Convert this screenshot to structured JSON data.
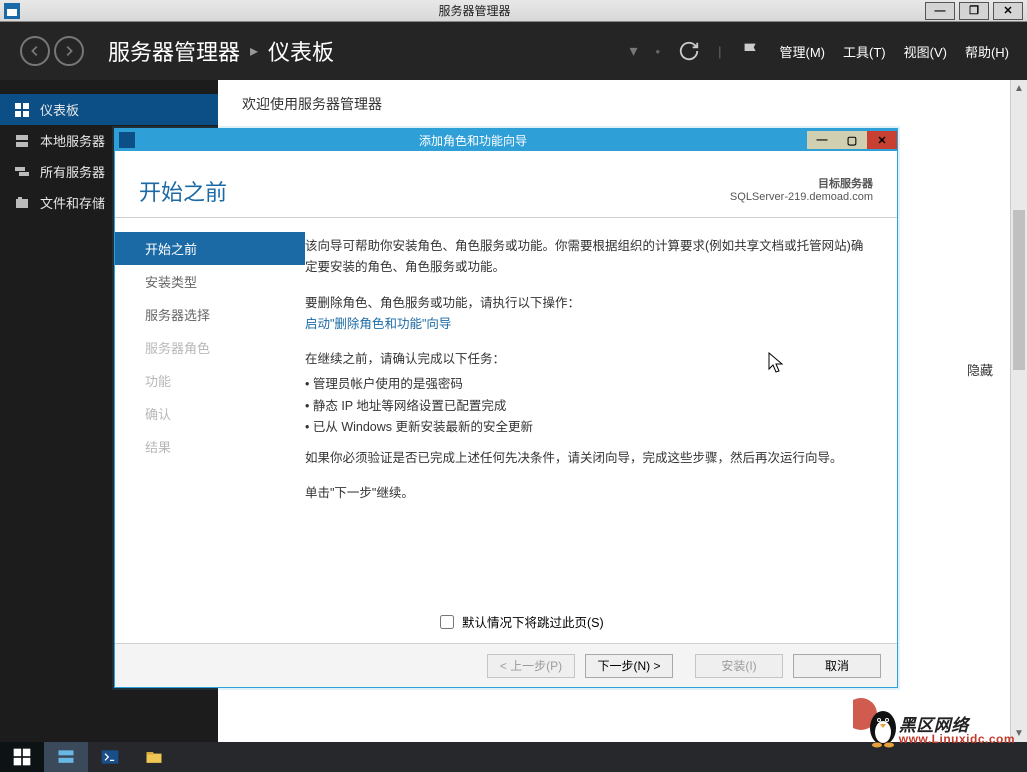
{
  "outerWindow": {
    "title": "服务器管理器",
    "minimize": "—",
    "maximize": "❐",
    "close": "✕"
  },
  "header": {
    "breadcrumb1": "服务器管理器",
    "breadcrumb2": "仪表板",
    "menu": {
      "manage": "管理(M)",
      "tools": "工具(T)",
      "view": "视图(V)",
      "help": "帮助(H)"
    }
  },
  "sidebar": {
    "items": [
      {
        "label": "仪表板"
      },
      {
        "label": "本地服务器"
      },
      {
        "label": "所有服务器"
      },
      {
        "label": "文件和存储"
      }
    ]
  },
  "main": {
    "welcome": "欢迎使用服务器管理器",
    "hide": "隐藏"
  },
  "wizard": {
    "windowTitle": "添加角色和功能向导",
    "headerTitle": "开始之前",
    "targetLabel": "目标服务器",
    "targetServer": "SQLServer-219.demoad.com",
    "nav": [
      {
        "label": "开始之前",
        "sel": true
      },
      {
        "label": "安装类型"
      },
      {
        "label": "服务器选择"
      },
      {
        "label": "服务器角色",
        "dis": true
      },
      {
        "label": "功能",
        "dis": true
      },
      {
        "label": "确认",
        "dis": true
      },
      {
        "label": "结果",
        "dis": true
      }
    ],
    "content": {
      "p1": "该向导可帮助你安装角色、角色服务或功能。你需要根据组织的计算要求(例如共享文档或托管网站)确定要安装的角色、角色服务或功能。",
      "p2": "要删除角色、角色服务或功能，请执行以下操作：",
      "link": "启动\"删除角色和功能\"向导",
      "p3": "在继续之前，请确认完成以下任务：",
      "b1": "管理员帐户使用的是强密码",
      "b2": "静态 IP 地址等网络设置已配置完成",
      "b3": "已从 Windows 更新安装最新的安全更新",
      "p4": "如果你必须验证是否已完成上述任何先决条件，请关闭向导，完成这些步骤，然后再次运行向导。",
      "p5": "单击\"下一步\"继续。"
    },
    "skip": "默认情况下将跳过此页(S)",
    "buttons": {
      "prev": "< 上一步(P)",
      "next": "下一步(N) >",
      "install": "安装(I)",
      "cancel": "取消"
    }
  },
  "watermark": {
    "main": "黑区网络",
    "sub": "www.Linuxidc.com"
  }
}
